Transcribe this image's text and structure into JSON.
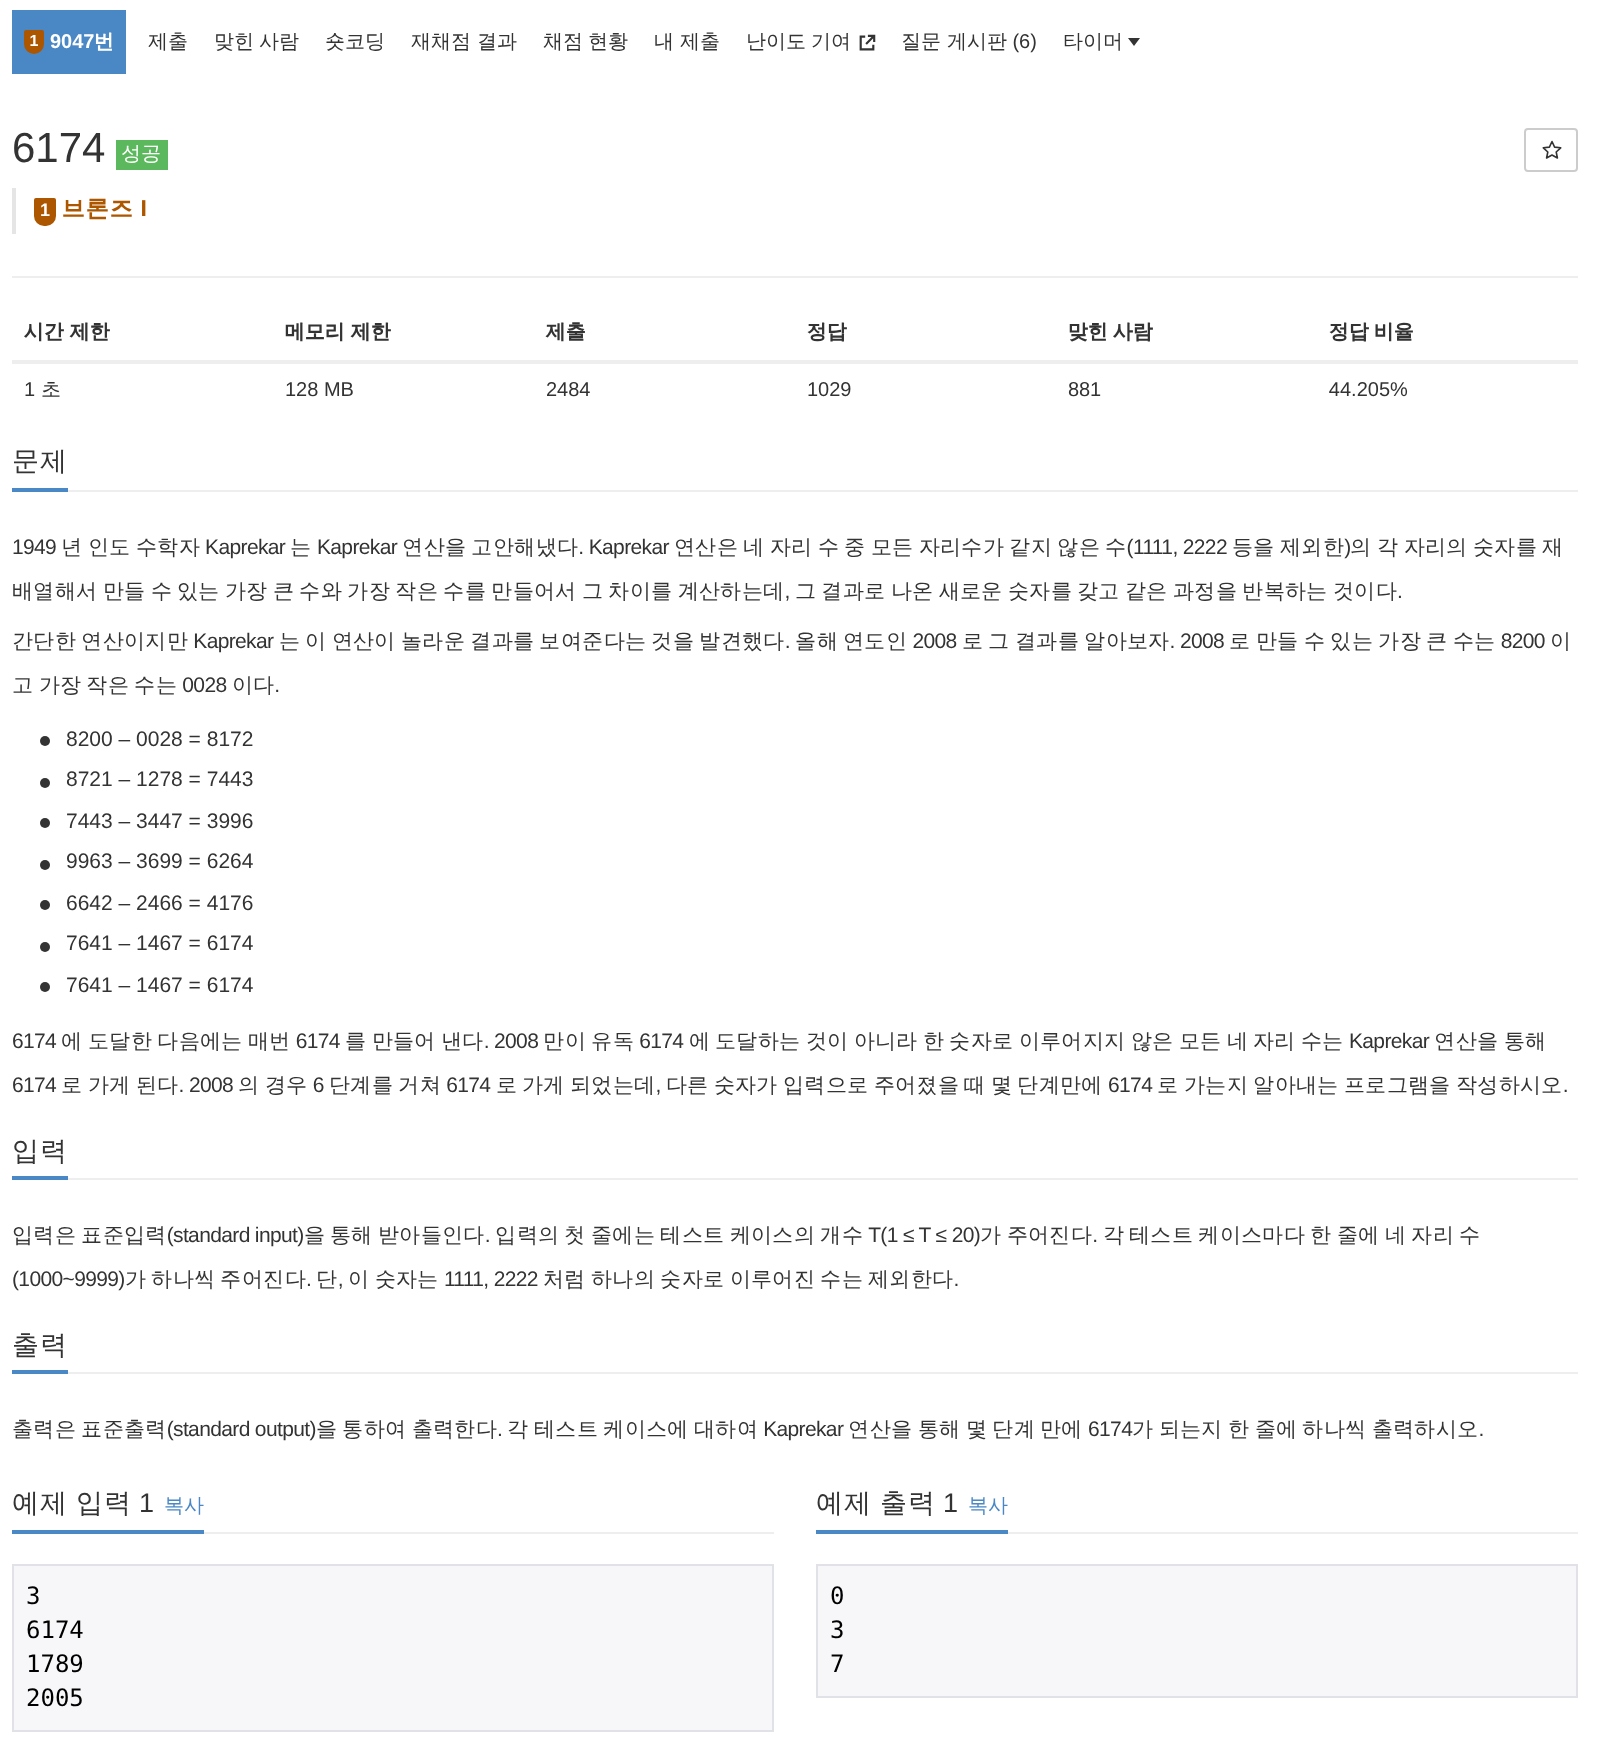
{
  "nav": {
    "tabs": [
      {
        "label": "9047번",
        "selected": true,
        "kind": "problem",
        "mark": "1"
      },
      {
        "label": "제출",
        "selected": false,
        "kind": "link"
      },
      {
        "label": "맞힌 사람",
        "selected": false,
        "kind": "link"
      },
      {
        "label": "숏코딩",
        "selected": false,
        "kind": "link"
      },
      {
        "label": "재채점 결과",
        "selected": false,
        "kind": "link"
      },
      {
        "label": "채점 현황",
        "selected": false,
        "kind": "link"
      },
      {
        "label": "내 제출",
        "selected": false,
        "kind": "link"
      },
      {
        "label": "난이도 기여",
        "selected": false,
        "kind": "external"
      },
      {
        "label": "질문 게시판 (6)",
        "selected": false,
        "kind": "link"
      },
      {
        "label": "타이머",
        "selected": false,
        "kind": "dropdown"
      }
    ]
  },
  "problem": {
    "title": "6174",
    "result": "성공",
    "starred": false,
    "tier": {
      "mark": "1",
      "label": "브론즈 I"
    }
  },
  "limits": {
    "columns": [
      "시간 제한",
      "메모리 제한",
      "제출",
      "정답",
      "맞힌 사람",
      "정답 비율"
    ],
    "rows": [
      [
        "1 초",
        "128 MB",
        "2484",
        "1029",
        "881",
        "44.205%"
      ]
    ]
  },
  "sections": [
    {
      "heading": "문제",
      "blocks": [
        {
          "kind": "paragraph",
          "text": "1949 년 인도 수학자 Kaprekar 는 Kaprekar 연산을 고안해냈다. Kaprekar 연산은 네 자리 수 중 모든 자리수가 같지 않은 수(1111, 2222 등을 제외한)의 각 자리의 숫자를 재배열해서 만들 수 있는 가장 큰 수와 가장 작은 수를 만들어서 그 차이를 계산하는데, 그 결과로 나온 새로운 숫자를 갖고 같은 과정을 반복하는 것이다."
        },
        {
          "kind": "paragraph",
          "text": "간단한 연산이지만 Kaprekar 는 이 연산이 놀라운 결과를 보여준다는 것을 발견했다. 올해 연도인 2008 로 그 결과를 알아보자. 2008 로 만들 수 있는 가장 큰 수는 8200 이고 가장 작은 수는 0028 이다."
        },
        {
          "kind": "list",
          "items": [
            "8200 – 0028 = 8172",
            "8721 – 1278 = 7443",
            "7443 – 3447 = 3996",
            "9963 – 3699 = 6264",
            "6642 – 2466 = 4176",
            "7641 – 1467 = 6174",
            "7641 – 1467 = 6174"
          ]
        },
        {
          "kind": "paragraph",
          "text": "6174 에 도달한 다음에는 매번 6174 를 만들어 낸다. 2008 만이 유독 6174 에 도달하는 것이 아니라 한 숫자로 이루어지지 않은 모든 네 자리 수는 Kaprekar 연산을 통해 6174 로 가게 된다. 2008 의 경우 6 단계를 거쳐 6174 로 가게 되었는데, 다른 숫자가 입력으로 주어졌을 때 몇 단계만에 6174 로 가는지 알아내는 프로그램을 작성하시오."
        }
      ]
    },
    {
      "heading": "입력",
      "blocks": [
        {
          "kind": "paragraph",
          "text": "입력은 표준입력(standard input)을 통해 받아들인다. 입력의 첫 줄에는 테스트 케이스의 개수 T(1 ≤ T ≤ 20)가 주어진다. 각 테스트 케이스마다 한 줄에 네 자리 수(1000~9999)가 하나씩 주어진다. 단, 이 숫자는 1111, 2222 처럼 하나의 숫자로 이루어진 수는 제외한다."
        }
      ]
    },
    {
      "heading": "출력",
      "blocks": [
        {
          "kind": "paragraph",
          "text": "출력은 표준출력(standard output)을 통하여 출력한다. 각 테스트 케이스에 대하여 Kaprekar 연산을 통해 몇 단계 만에 6174가 되는지 한 줄에 하나씩 출력하시오."
        }
      ]
    }
  ],
  "samples": [
    {
      "heading": "예제 입력 1",
      "copy": "복사",
      "lines": [
        "3",
        "6174",
        "1789",
        "2005"
      ]
    },
    {
      "heading": "예제 출력 1",
      "copy": "복사",
      "lines": [
        "0",
        "3",
        "7"
      ]
    }
  ]
}
